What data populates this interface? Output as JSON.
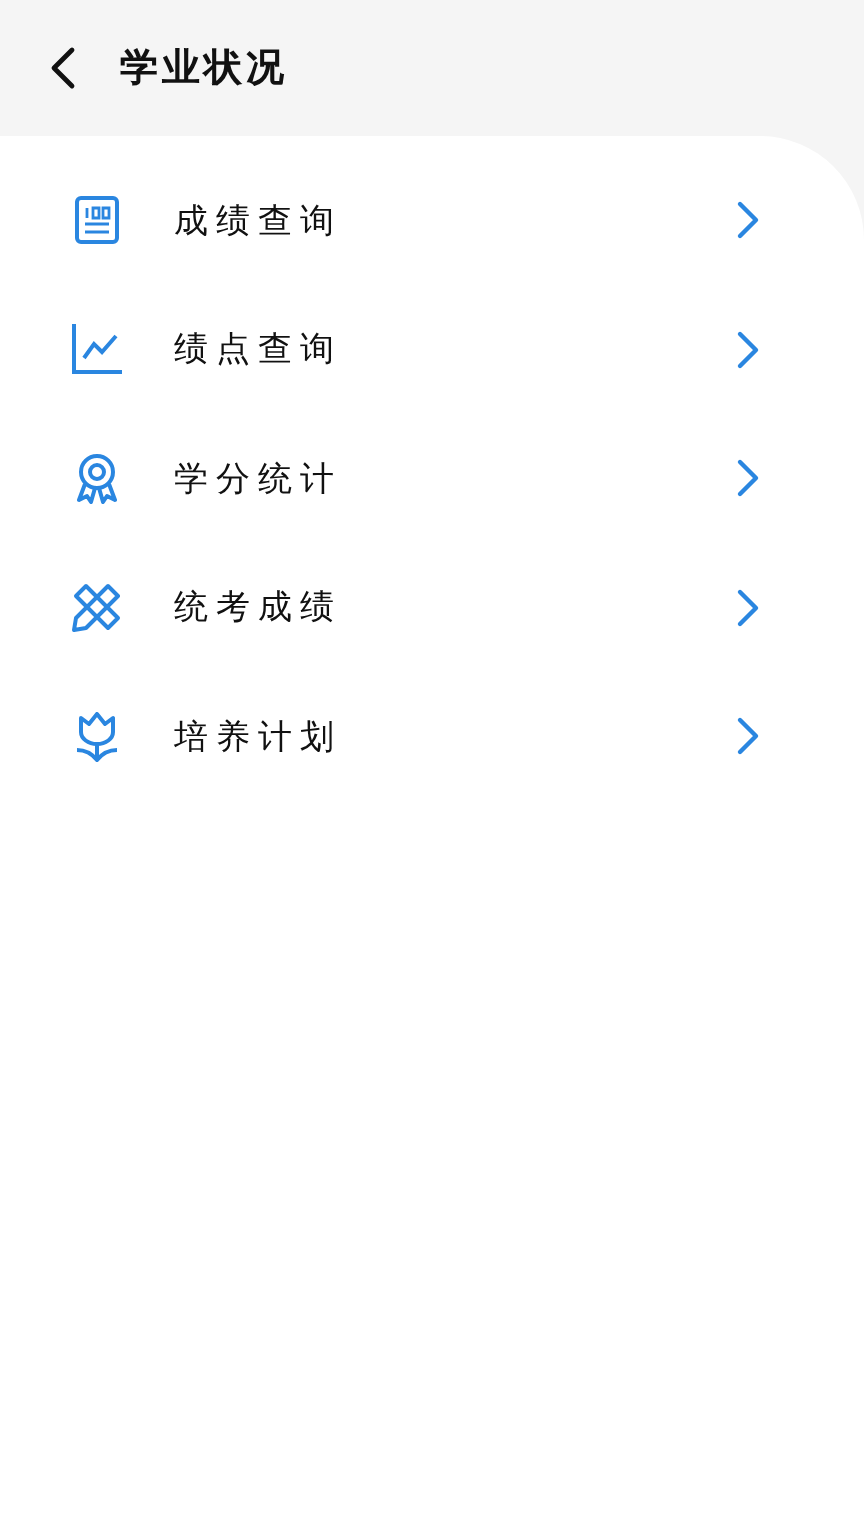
{
  "header": {
    "title": "学业状况"
  },
  "items": [
    {
      "label": "成绩查询",
      "kind": "scores"
    },
    {
      "label": "绩点查询",
      "kind": "chart"
    },
    {
      "label": "学分统计",
      "kind": "award"
    },
    {
      "label": "统考成绩",
      "kind": "tools"
    },
    {
      "label": "培养计划",
      "kind": "flower"
    }
  ]
}
